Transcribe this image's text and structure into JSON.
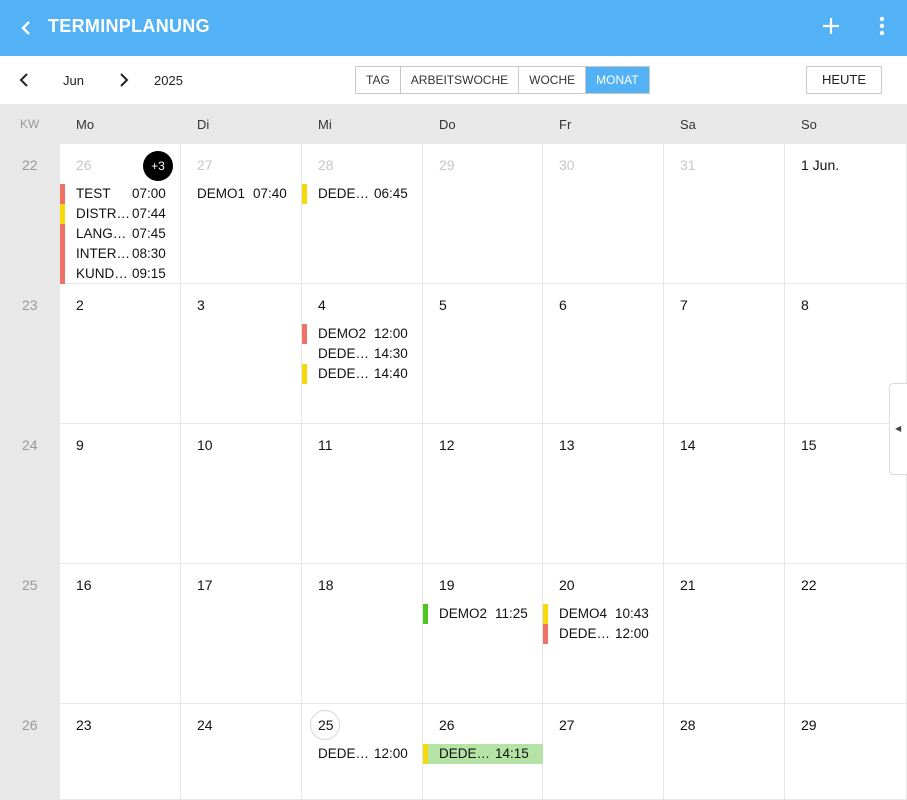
{
  "header": {
    "title": "TERMINPLANUNG"
  },
  "toolbar": {
    "month": "Jun",
    "year": "2025",
    "views": [
      "TAG",
      "ARBEITSWOCHE",
      "WOCHE",
      "MONAT"
    ],
    "active_view": "MONAT",
    "today_label": "HEUTE"
  },
  "grid": {
    "kw_label": "KW",
    "weekdays": [
      "Mo",
      "Di",
      "Mi",
      "Do",
      "Fr",
      "Sa",
      "So"
    ],
    "weeks": [
      {
        "kw": "22",
        "days": [
          "26",
          "27",
          "28",
          "29",
          "30",
          "31",
          "1 Jun."
        ]
      },
      {
        "kw": "23",
        "days": [
          "2",
          "3",
          "4",
          "5",
          "6",
          "7",
          "8"
        ]
      },
      {
        "kw": "24",
        "days": [
          "9",
          "10",
          "11",
          "12",
          "13",
          "14",
          "15"
        ]
      },
      {
        "kw": "25",
        "days": [
          "16",
          "17",
          "18",
          "19",
          "20",
          "21",
          "22"
        ]
      },
      {
        "kw": "26",
        "days": [
          "23",
          "24",
          "25",
          "26",
          "27",
          "28",
          "29"
        ]
      }
    ],
    "more_badge": "+3"
  },
  "events": {
    "w0_mo": [
      {
        "name": "TEST",
        "time": "07:00",
        "color": "#f07166"
      },
      {
        "name": "DISTRIBUTION",
        "time": "07:44",
        "color": "#f5d90a"
      },
      {
        "name": "LANGERTERMIN",
        "time": "07:45",
        "color": "#f07166"
      },
      {
        "name": "INTERESSENT",
        "time": "08:30",
        "color": "#f07166"
      },
      {
        "name": "KUNDE BESUCH",
        "time": "09:15",
        "color": "#f07166"
      }
    ],
    "w0_di": [
      {
        "name": "DEMO1",
        "time": "07:40",
        "color": ""
      }
    ],
    "w0_mi": [
      {
        "name": "DEDENETERMIN",
        "time": "06:45",
        "color": "#f5d90a"
      }
    ],
    "w1_mi": [
      {
        "name": "DEMO2",
        "time": "12:00",
        "color": "#f07166"
      },
      {
        "name": "DEDENETERMIN",
        "time": "14:30",
        "color": ""
      },
      {
        "name": "DEDENETERMIN",
        "time": "14:40",
        "color": "#f5d90a"
      }
    ],
    "w3_do": [
      {
        "name": "DEMO2",
        "time": "11:25",
        "color": "#4cc51f"
      }
    ],
    "w3_fr": [
      {
        "name": "DEMO4",
        "time": "10:43",
        "color": "#f5d90a"
      },
      {
        "name": "DEDENETERMIN",
        "time": "12:00",
        "color": "#f07166"
      }
    ],
    "w4_mi": [
      {
        "name": "DEDENETERMIN",
        "time": "12:00",
        "color": ""
      }
    ],
    "w4_do": [
      {
        "name": "DEDENETERMIN",
        "time": "14:15",
        "color": "#f5d90a",
        "highlight": "#b5e3a6"
      }
    ]
  }
}
